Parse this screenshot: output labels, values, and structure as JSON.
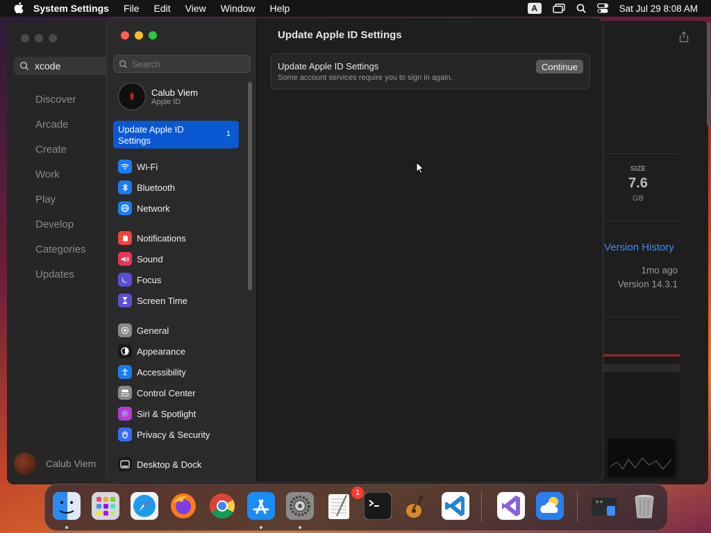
{
  "menubar": {
    "app_name": "System Settings",
    "menus": [
      "File",
      "Edit",
      "View",
      "Window",
      "Help"
    ],
    "input_source": "A",
    "clock": "Sat Jul 29  8:08 AM"
  },
  "app_store": {
    "search_value": "xcode",
    "nav": [
      "Discover",
      "Arcade",
      "Create",
      "Work",
      "Play",
      "Develop",
      "Categories",
      "Updates"
    ],
    "user_name": "Calub Viem",
    "size_label": "SIZE",
    "size_value": "7.6",
    "size_unit": "GB",
    "version_history": "Version History",
    "updated_ago": "1mo ago",
    "version": "Version 14.3.1"
  },
  "settings": {
    "search_placeholder": "Search",
    "account": {
      "name": "Calub Viem",
      "subtitle": "Apple ID"
    },
    "selected_item": {
      "label": "Update Apple ID Settings",
      "badge": "1"
    },
    "sidebar_groups": [
      [
        {
          "label": "Wi-Fi",
          "icon": "wifi-icon",
          "color": "#1a7cf5"
        },
        {
          "label": "Bluetooth",
          "icon": "bluetooth-icon",
          "color": "#1a7cf5"
        },
        {
          "label": "Network",
          "icon": "globe-icon",
          "color": "#1a7cf5"
        }
      ],
      [
        {
          "label": "Notifications",
          "icon": "bell-icon",
          "color": "#f0443a"
        },
        {
          "label": "Sound",
          "icon": "speaker-icon",
          "color": "#e8345a"
        },
        {
          "label": "Focus",
          "icon": "moon-icon",
          "color": "#5b4fd6"
        },
        {
          "label": "Screen Time",
          "icon": "hourglass-icon",
          "color": "#5b4fd6"
        }
      ],
      [
        {
          "label": "General",
          "icon": "gear-icon",
          "color": "#8a8a8a"
        },
        {
          "label": "Appearance",
          "icon": "appearance-icon",
          "color": "#1a1a1a"
        },
        {
          "label": "Accessibility",
          "icon": "accessibility-icon",
          "color": "#1a7cf5"
        },
        {
          "label": "Control Center",
          "icon": "control-center-icon",
          "color": "#8a8a8a"
        },
        {
          "label": "Siri & Spotlight",
          "icon": "siri-icon",
          "color": "#b03fd0"
        },
        {
          "label": "Privacy & Security",
          "icon": "hand-icon",
          "color": "#3b6ef5"
        }
      ],
      [
        {
          "label": "Desktop & Dock",
          "icon": "dock-icon",
          "color": "#1a1a1a"
        }
      ]
    ],
    "main_title": "Update Apple ID Settings",
    "card": {
      "title": "Update Apple ID Settings",
      "description": "Some account services require you to sign in again.",
      "button": "Continue"
    }
  },
  "dock": {
    "apps": [
      {
        "name": "finder-icon",
        "color": "#2b8cf0",
        "running": true
      },
      {
        "name": "launchpad-icon",
        "color": "#c9c9d4",
        "running": false
      },
      {
        "name": "safari-icon",
        "color": "#1e9bf0",
        "running": false
      },
      {
        "name": "firefox-icon",
        "color": "#ff7a1a",
        "running": false
      },
      {
        "name": "chrome-icon",
        "color": "#ffffff",
        "running": false
      },
      {
        "name": "app-store-icon",
        "color": "#1a8cf5",
        "running": true
      },
      {
        "name": "system-settings-icon",
        "color": "#7a7a7a",
        "running": true
      },
      {
        "name": "textedit-icon",
        "color": "#f2f2f2",
        "running": false
      },
      {
        "name": "terminal-icon",
        "color": "#1a1a1a",
        "running": false
      },
      {
        "name": "garageband-icon",
        "color": "#d88a2a",
        "running": false
      },
      {
        "name": "vscode-icon",
        "color": "#ffffff",
        "running": false
      },
      {
        "name": "visual-studio-icon",
        "color": "#ffffff",
        "running": false
      },
      {
        "name": "weather-icon",
        "color": "#2a7ef0",
        "running": false
      },
      {
        "name": "downloads-stack-icon",
        "color": "#2a2a2a",
        "running": false
      },
      {
        "name": "trash-icon",
        "color": "#9a9a9a",
        "running": false
      }
    ],
    "settings_badge": "1"
  }
}
